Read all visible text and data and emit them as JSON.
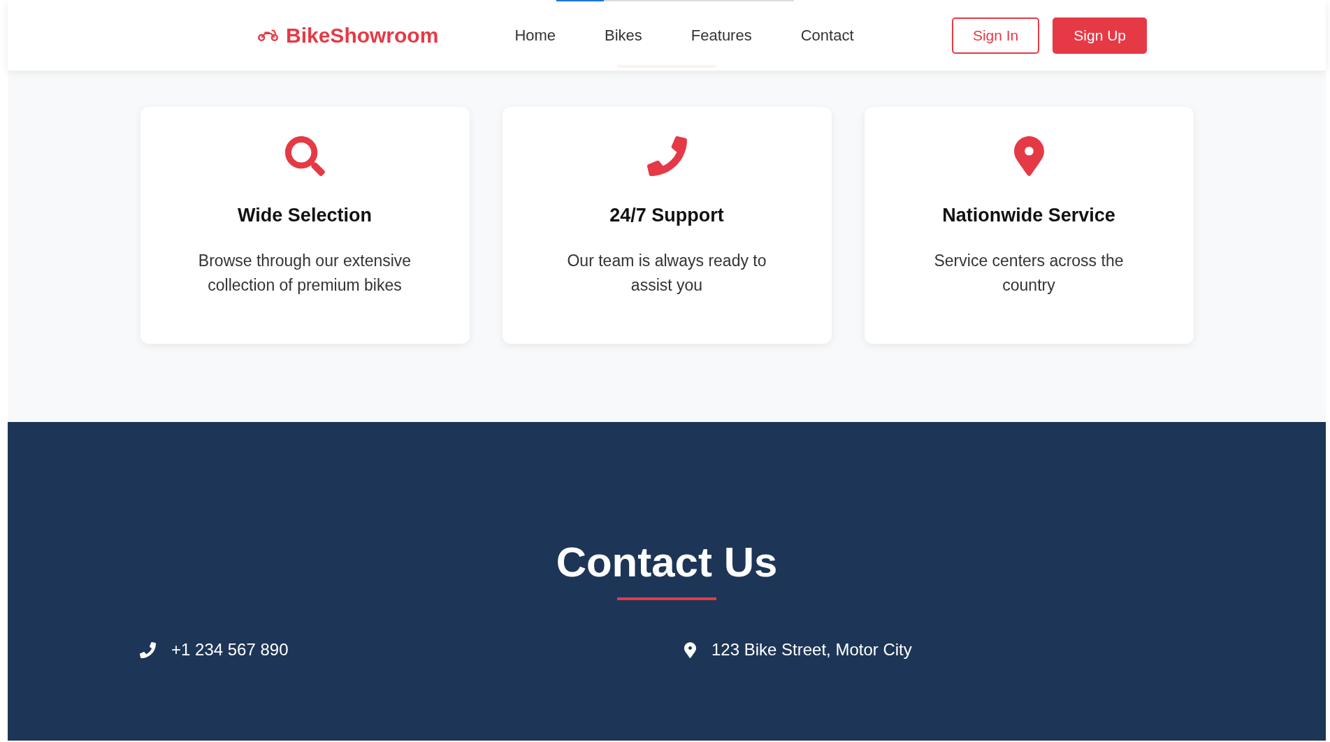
{
  "header": {
    "logo": "BikeShowroom",
    "nav": [
      "Home",
      "Bikes",
      "Features",
      "Contact"
    ],
    "buttons": [
      {
        "label": "Sign In",
        "kind": "outline"
      },
      {
        "label": "Sign Up",
        "kind": "primary"
      }
    ]
  },
  "features": {
    "cards": [
      {
        "title": "Wide Selection",
        "text": "Browse through our extensive collection of premium bikes"
      },
      {
        "title": "24/7 Support",
        "text": "Our team is always ready to assist you"
      },
      {
        "title": "Nationwide Service",
        "text": "Service centers across the country"
      }
    ]
  },
  "contact": {
    "title": "Contact Us",
    "items": [
      {
        "kind": "phone",
        "text": "+1 234 567 890"
      },
      {
        "kind": "address",
        "text": "123 Bike Street, Motor City"
      }
    ]
  }
}
